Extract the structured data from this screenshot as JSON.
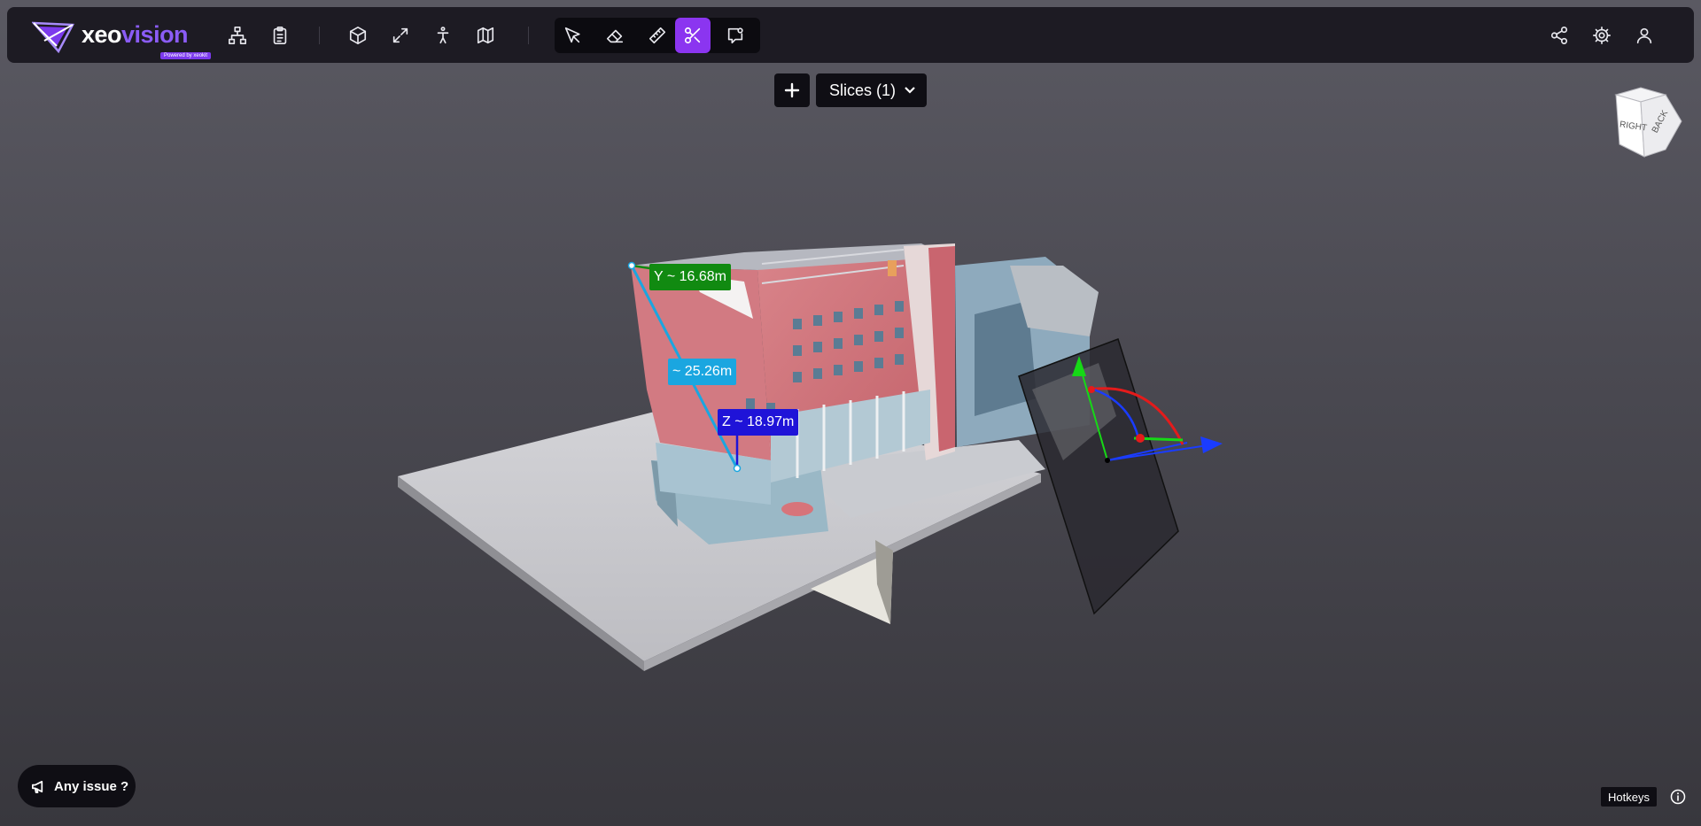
{
  "brand": {
    "name_plain": "xeo",
    "name_accent": "vision",
    "badge": "Powered by xeokit"
  },
  "toolbar": {
    "left_icons": [
      "tree-hierarchy-icon",
      "clipboard-list-icon"
    ],
    "view_icons": [
      "cube-icon",
      "expand-arrows-icon",
      "walk-person-icon",
      "map-icon"
    ],
    "tool_icons": [
      "pointer-icon",
      "eraser-icon",
      "ruler-icon",
      "scissors-icon",
      "comment-icon"
    ],
    "active_tool": "scissors-icon",
    "right_icons": [
      "share-icon",
      "gear-icon",
      "user-icon"
    ],
    "accent_color": "#8b35f0"
  },
  "slices": {
    "add_label": "+",
    "dropdown_label": "Slices (1)"
  },
  "navcube": {
    "face_right": "RIGHT",
    "face_back": "BACK"
  },
  "measurements": {
    "y_label": "Y ~ 16.68m",
    "distance_label": "~ 25.26m",
    "z_label": "Z ~ 18.97m",
    "colors": {
      "y": "#118a11",
      "distance": "#1aa6e0",
      "z": "#1f13d8"
    }
  },
  "footer": {
    "issue_label": "Any issue ?",
    "hotkeys_label": "Hotkeys"
  }
}
